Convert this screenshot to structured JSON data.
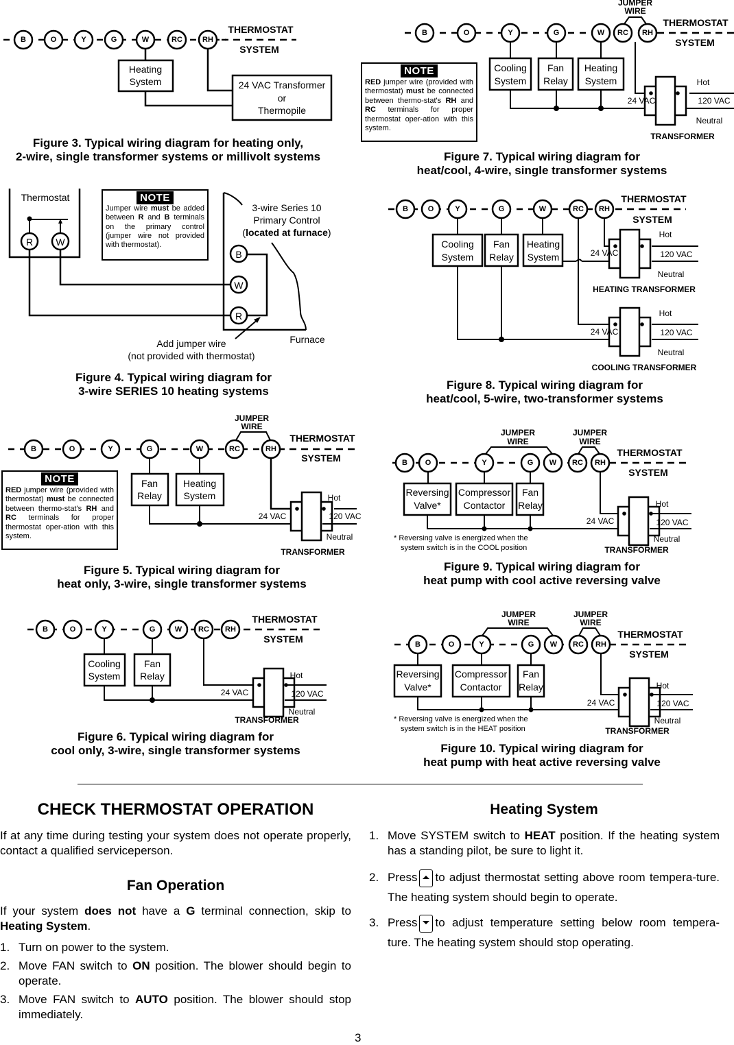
{
  "terminals": [
    "B",
    "O",
    "Y",
    "G",
    "W",
    "RC",
    "RH"
  ],
  "common": {
    "thermostat": "THERMOSTAT",
    "system": "SYSTEM",
    "transformer": "TRANSFORMER",
    "hot": "Hot",
    "neutral": "Neutral",
    "vac24": "24 VAC",
    "vac120": "120 VAC",
    "jumper_line1": "JUMPER",
    "jumper_line2": "WIRE"
  },
  "figure3": {
    "heating_line1": "Heating",
    "heating_line2": "System",
    "source_line1": "24 VAC Transformer",
    "source_line2": "or",
    "source_line3": "Thermopile",
    "caption_line1": "Figure 3. Typical wiring diagram for heating only,",
    "caption_line2": "2-wire, single transformer systems or millivolt systems"
  },
  "figure4": {
    "thermostat_label": "Thermostat",
    "term_r": "R",
    "term_w": "W",
    "term_b": "B",
    "note_title": "NOTE",
    "note_text_html": "Jumper wire <b>must</b> be added between <b>R</b> and <b>B</b> terminals on the primary control (jumper wire not provided with thermostat).",
    "primary_line1": "3-wire Series 10",
    "primary_line2": "Primary Control",
    "primary_line3_pre": "(",
    "primary_line3_bold": "located at furnace",
    "primary_line3_post": ")",
    "furnace": "Furnace",
    "jumper_line1": "Add jumper wire",
    "jumper_line2": "(not provided with thermostat)",
    "caption_line1": "Figure 4. Typical wiring diagram for",
    "caption_line2": "3-wire SERIES 10 heating systems"
  },
  "figure5": {
    "note_title": "NOTE",
    "note_text_html": "<b>RED</b> jumper wire (provided with thermostat) <b>must</b> be connected between thermo-stat's <b>RH</b> and <b>RC</b> terminals for proper thermostat oper-ation with this system.",
    "fan_line1": "Fan",
    "fan_line2": "Relay",
    "heating_line1": "Heating",
    "heating_line2": "System",
    "caption_line1": "Figure 5. Typical wiring diagram for",
    "caption_line2": "heat only,  3-wire, single transformer systems"
  },
  "figure6": {
    "cooling_line1": "Cooling",
    "cooling_line2": "System",
    "fan_line1": "Fan",
    "fan_line2": "Relay",
    "caption_line1": "Figure 6. Typical wiring diagram for",
    "caption_line2": "cool only, 3-wire, single transformer systems"
  },
  "figure7": {
    "note_title": "NOTE",
    "note_text_html": "<b>RED</b> jumper wire (provided with thermostat) <b>must</b> be connected between thermo-stat's <b>RH</b> and <b>RC</b> terminals for proper thermostat oper-ation with this system.",
    "cooling_line1": "Cooling",
    "cooling_line2": "System",
    "fan_line1": "Fan",
    "fan_line2": "Relay",
    "heating_line1": "Heating",
    "heating_line2": "System",
    "caption_line1": "Figure 7. Typical wiring diagram for",
    "caption_line2": "heat/cool, 4-wire, single transformer systems"
  },
  "figure8": {
    "cooling_line1": "Cooling",
    "cooling_line2": "System",
    "fan_line1": "Fan",
    "fan_line2": "Relay",
    "heating_line1": "Heating",
    "heating_line2": "System",
    "heating_transformer": "HEATING TRANSFORMER",
    "cooling_transformer": "COOLING TRANSFORMER",
    "caption_line1": "Figure 8. Typical wiring diagram for",
    "caption_line2": "heat/cool, 5-wire, two-transformer systems"
  },
  "figure9": {
    "rev_line1": "Reversing",
    "rev_line2": "Valve*",
    "comp_line1": "Compressor",
    "comp_line2": "Contactor",
    "fan_line1": "Fan",
    "fan_line2": "Relay",
    "footnote_line1": "* Reversing valve is energized when the",
    "footnote_line2": "system switch is in the COOL position",
    "caption_line1": "Figure 9. Typical wiring diagram for",
    "caption_line2": "heat pump with cool active reversing valve"
  },
  "figure10": {
    "rev_line1": "Reversing",
    "rev_line2": "Valve*",
    "comp_line1": "Compressor",
    "comp_line2": "Contactor",
    "fan_line1": "Fan",
    "fan_line2": "Relay",
    "footnote_line1": "* Reversing valve is energized when the",
    "footnote_line2": "system switch is in the HEAT position",
    "caption_line1": "Figure 10. Typical wiring diagram for",
    "caption_line2": "heat pump with heat active reversing valve"
  },
  "check_operation": {
    "title": "CHECK THERMOSTAT OPERATION",
    "intro": "If at any time during testing your system does not operate properly, contact a qualified serviceperson.",
    "fan": {
      "title": "Fan Operation",
      "intro_html": "If your system <b>does not</b> have a <b>G</b> terminal connection, skip to <b>Heating System</b>.",
      "steps": [
        {
          "num": "1.",
          "html": "Turn on power to the system."
        },
        {
          "num": "2.",
          "html": "Move FAN switch to <b>ON</b> position. The blower should begin to operate."
        },
        {
          "num": "3.",
          "html": "Move FAN switch to <b>AUTO</b> position. The blower should stop immediately."
        }
      ]
    },
    "heating": {
      "title": "Heating System",
      "steps": [
        {
          "num": "1.",
          "html": "Move SYSTEM switch to <b>HEAT</b> position. If the heating system has a standing pilot, be sure to light it."
        },
        {
          "num": "2.",
          "pre": "Press",
          "key": "up-arrow-key",
          "post": "to adjust thermostat setting above room tempera-ture. The heating system should begin to operate."
        },
        {
          "num": "3.",
          "pre": "Press",
          "key": "down-arrow-key",
          "post": "to adjust temperature setting below room tempera-ture. The heating system should stop operating."
        }
      ]
    }
  },
  "page_number": "3"
}
